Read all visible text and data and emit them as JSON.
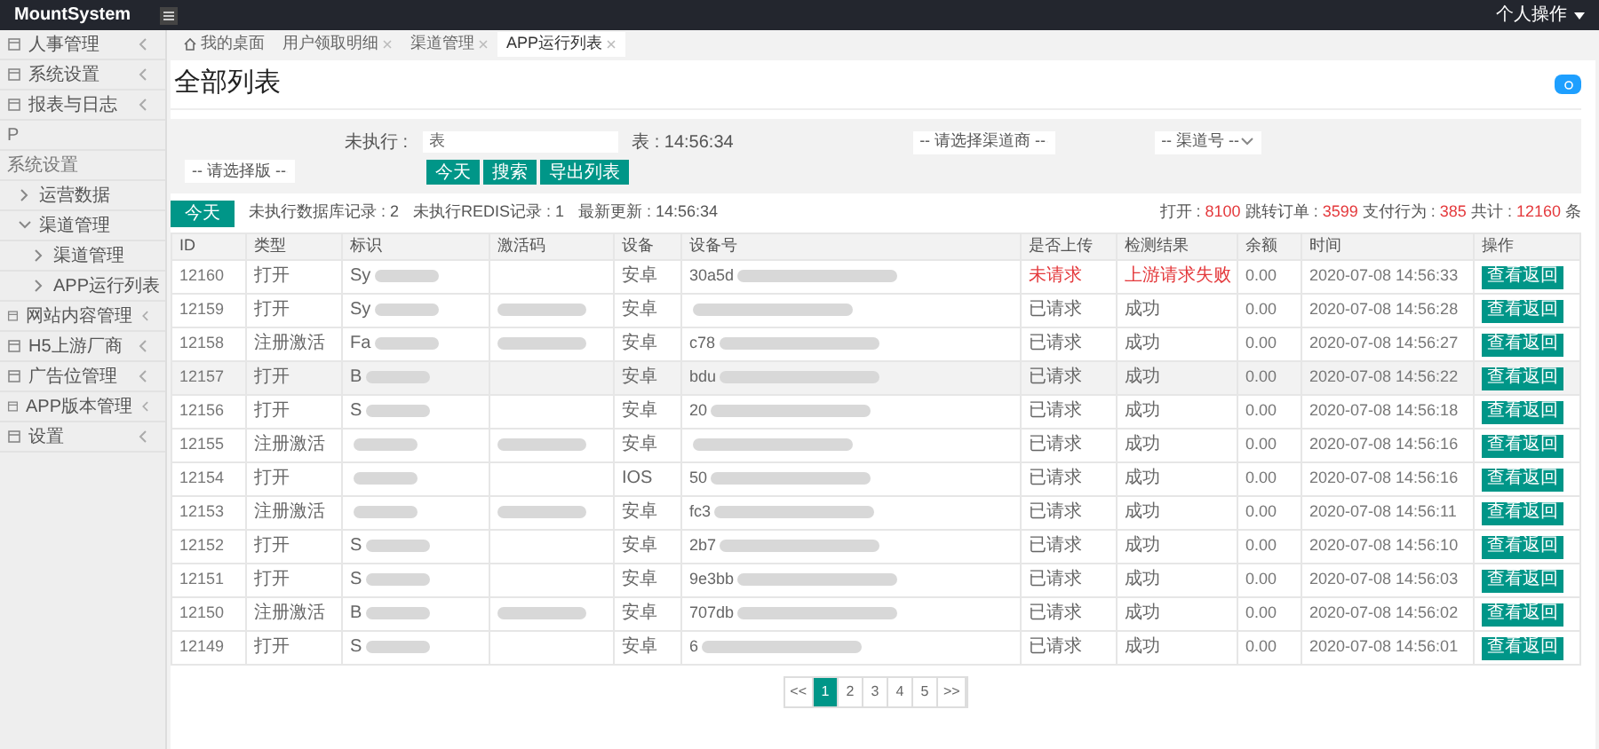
{
  "topbar": {
    "brand": "MountSystem",
    "user_menu": "个人操作"
  },
  "sidebar": {
    "items": [
      {
        "label": "人事管理",
        "expanded": false
      },
      {
        "label": "系统设置",
        "expanded": false
      },
      {
        "label": "报表与日志",
        "expanded": false
      },
      {
        "label": "P",
        "kind": "stray"
      },
      {
        "label": "系统设置",
        "kind": "stray"
      },
      {
        "label": "运营数据",
        "kind": "child"
      },
      {
        "label": "渠道管理",
        "kind": "child",
        "expanded": true,
        "children": [
          {
            "label": "渠道管理"
          },
          {
            "label": "APP运行列表"
          }
        ]
      },
      {
        "label": "网站内容管理",
        "expanded": false
      },
      {
        "label": "H5上游厂商",
        "expanded": false
      },
      {
        "label": "广告位管理",
        "expanded": false
      },
      {
        "label": "APP版本管理",
        "expanded": false
      },
      {
        "label": "设置",
        "expanded": false
      }
    ]
  },
  "tabs": [
    {
      "label": "我的桌面",
      "kind": "home",
      "selected": false
    },
    {
      "label": "用户领取明细",
      "kind": "tab",
      "selected": false
    },
    {
      "label": "渠道管理",
      "kind": "tab",
      "selected": false
    },
    {
      "label": "APP运行列表",
      "kind": "tab",
      "selected": true
    }
  ],
  "page_title": "全部列表",
  "filters": {
    "label": "未执行 :",
    "input_value": "表",
    "time_text": "表 : 14:56:34",
    "selects": [
      "-- 请选择渠道商 --",
      "-- 渠道号 --",
      "-- 请选择版 --"
    ],
    "buttons": [
      "今天",
      "搜索",
      "导出列表"
    ]
  },
  "info": {
    "button": "今天",
    "items": [
      "未执行数据库记录 : 2",
      "未执行REDIS记录 : 1",
      "最新更新 : 14:56:34"
    ],
    "stats": [
      {
        "label": "打开 :",
        "value": "8100"
      },
      {
        "label": "跳转订单 :",
        "value": "3599"
      },
      {
        "label": "支付行为 :",
        "value": "385"
      },
      {
        "label": "共计 :",
        "value": "12160"
      },
      {
        "label": "条"
      }
    ]
  },
  "table": {
    "columns": [
      "ID",
      "类型",
      "标识",
      "激活码",
      "设备",
      "设备号",
      "是否上传",
      "检测结果",
      "余额",
      "时间",
      "操作"
    ],
    "rows": [
      {
        "id": "12160",
        "type": "打开",
        "tag": "Sy",
        "code_blurred": false,
        "device": "安卓",
        "device_no": "30a5d",
        "upload": "未请求",
        "result": "上游请求失败",
        "failed": true,
        "balance": "0.00",
        "time": "2020-07-08 14:56:33",
        "action": "查看返回",
        "selected": false
      },
      {
        "id": "12159",
        "type": "打开",
        "tag": "Sy",
        "code_blurred": true,
        "device": "安卓",
        "device_no": "",
        "upload": "已请求",
        "result": "成功",
        "failed": false,
        "balance": "0.00",
        "time": "2020-07-08 14:56:28",
        "action": "查看返回",
        "selected": false
      },
      {
        "id": "12158",
        "type": "注册激活",
        "tag": "Fa",
        "code_blurred": true,
        "device": "安卓",
        "device_no": "c78",
        "upload": "已请求",
        "result": "成功",
        "failed": false,
        "balance": "0.00",
        "time": "2020-07-08 14:56:27",
        "action": "查看返回",
        "selected": false
      },
      {
        "id": "12157",
        "type": "打开",
        "tag": "B",
        "code_blurred": false,
        "device": "安卓",
        "device_no": "bdu",
        "upload": "已请求",
        "result": "成功",
        "failed": false,
        "balance": "0.00",
        "time": "2020-07-08 14:56:22",
        "action": "查看返回",
        "selected": true
      },
      {
        "id": "12156",
        "type": "打开",
        "tag": "S",
        "code_blurred": false,
        "device": "安卓",
        "device_no": "20",
        "upload": "已请求",
        "result": "成功",
        "failed": false,
        "balance": "0.00",
        "time": "2020-07-08 14:56:18",
        "action": "查看返回",
        "selected": false
      },
      {
        "id": "12155",
        "type": "注册激活",
        "tag": "",
        "code_blurred": true,
        "device": "安卓",
        "device_no": "",
        "upload": "已请求",
        "result": "成功",
        "failed": false,
        "balance": "0.00",
        "time": "2020-07-08 14:56:16",
        "action": "查看返回",
        "selected": false
      },
      {
        "id": "12154",
        "type": "打开",
        "tag": "",
        "code_blurred": false,
        "device": "IOS",
        "device_no": "50",
        "upload": "已请求",
        "result": "成功",
        "failed": false,
        "balance": "0.00",
        "time": "2020-07-08 14:56:16",
        "action": "查看返回",
        "selected": false
      },
      {
        "id": "12153",
        "type": "注册激活",
        "tag": "",
        "code_blurred": true,
        "device": "安卓",
        "device_no": "fc3",
        "upload": "已请求",
        "result": "成功",
        "failed": false,
        "balance": "0.00",
        "time": "2020-07-08 14:56:11",
        "action": "查看返回",
        "selected": false
      },
      {
        "id": "12152",
        "type": "打开",
        "tag": "S",
        "code_blurred": false,
        "device": "安卓",
        "device_no": "2b7",
        "upload": "已请求",
        "result": "成功",
        "failed": false,
        "balance": "0.00",
        "time": "2020-07-08 14:56:10",
        "action": "查看返回",
        "selected": false
      },
      {
        "id": "12151",
        "type": "打开",
        "tag": "S",
        "code_blurred": false,
        "device": "安卓",
        "device_no": "9e3bb",
        "upload": "已请求",
        "result": "成功",
        "failed": false,
        "balance": "0.00",
        "time": "2020-07-08 14:56:03",
        "action": "查看返回",
        "selected": false
      },
      {
        "id": "12150",
        "type": "注册激活",
        "tag": "B",
        "code_blurred": true,
        "device": "安卓",
        "device_no": "707db",
        "upload": "已请求",
        "result": "成功",
        "failed": false,
        "balance": "0.00",
        "time": "2020-07-08 14:56:02",
        "action": "查看返回",
        "selected": false
      },
      {
        "id": "12149",
        "type": "打开",
        "tag": "S",
        "code_blurred": false,
        "device": "安卓",
        "device_no": "6",
        "upload": "已请求",
        "result": "成功",
        "failed": false,
        "balance": "0.00",
        "time": "2020-07-08 14:56:01",
        "action": "查看返回",
        "selected": false
      }
    ]
  },
  "pagination": [
    {
      "label": "<<",
      "selected": false
    },
    {
      "label": "1",
      "selected": true
    },
    {
      "label": "2",
      "selected": false
    },
    {
      "label": "3",
      "selected": false
    },
    {
      "label": "4",
      "selected": false
    },
    {
      "label": "5",
      "selected": false
    },
    {
      "label": ">>",
      "selected": false
    }
  ]
}
